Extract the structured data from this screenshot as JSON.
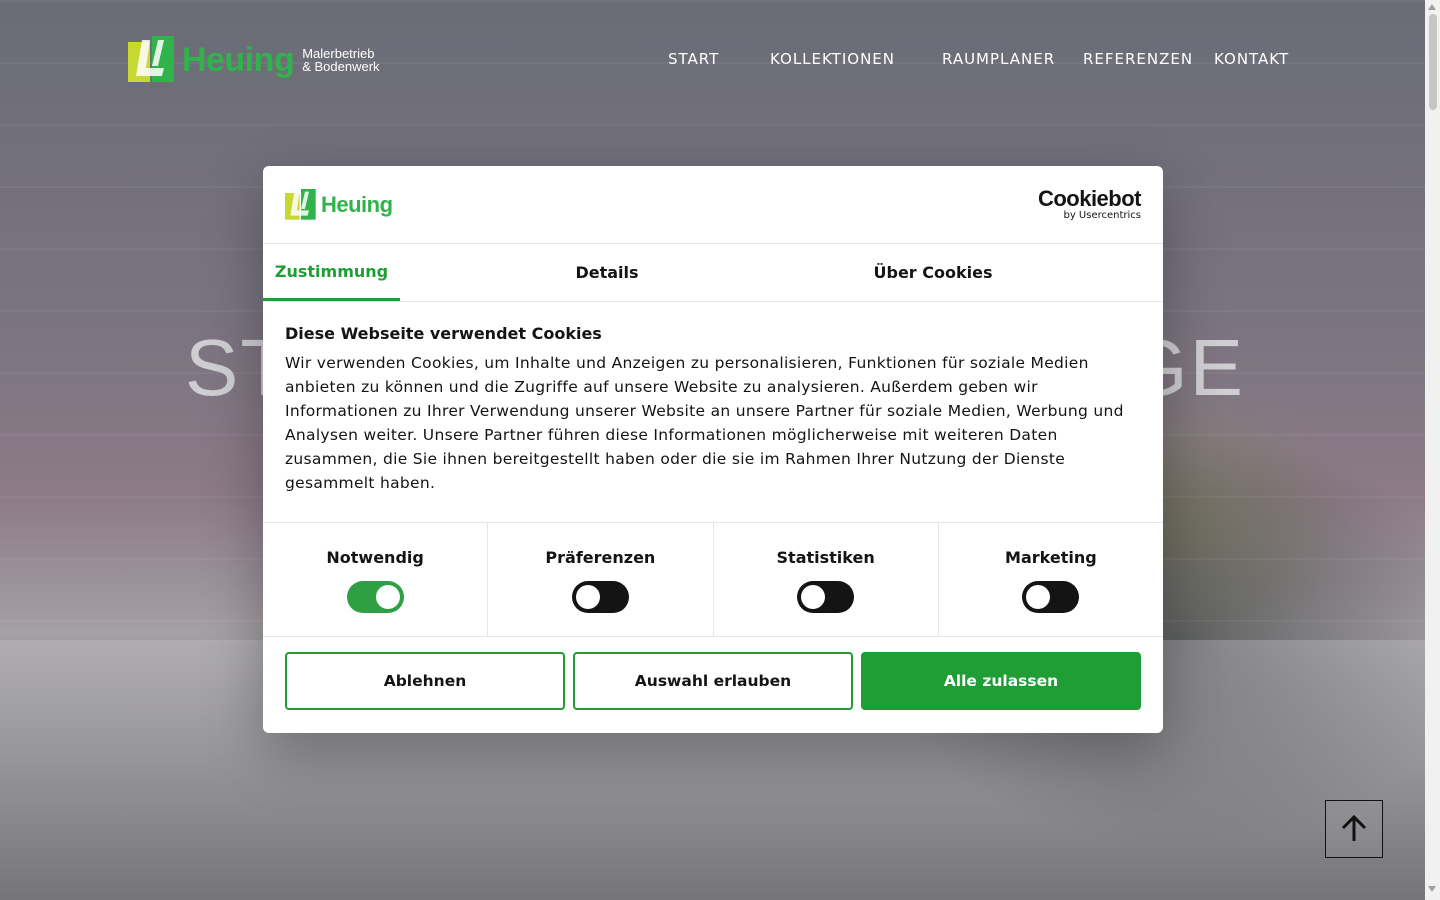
{
  "brand": {
    "name": "Heuing",
    "tagline_line1": "Malerbetrieb",
    "tagline_line2": "& Bodenwerk",
    "green": "#2fb34a",
    "lime": "#c8d832"
  },
  "nav": {
    "items": [
      {
        "label": "START"
      },
      {
        "label": "KOLLEKTIONEN"
      },
      {
        "label": "RAUMPLANER"
      },
      {
        "label": "REFERENZEN"
      },
      {
        "label": "KONTAKT"
      }
    ]
  },
  "hero": {
    "title_left": "ST",
    "title_right": "GE"
  },
  "cookie_dialog": {
    "logo_text": "Heuing",
    "provider": "Cookiebot",
    "provider_sub": "by Usercentrics",
    "tabs": [
      {
        "label": "Zustimmung",
        "active": true
      },
      {
        "label": "Details",
        "active": false
      },
      {
        "label": "Über Cookies",
        "active": false
      }
    ],
    "heading": "Diese Webseite verwendet Cookies",
    "body": "Wir verwenden Cookies, um Inhalte und Anzeigen zu personalisieren, Funktionen für soziale Medien anbieten zu können und die Zugriffe auf unsere Website zu analysieren. Außerdem geben wir Informationen zu Ihrer Verwendung unserer Website an unsere Partner für soziale Medien, Werbung und Analysen weiter. Unsere Partner führen diese Informationen möglicherweise mit weiteren Daten zusammen, die Sie ihnen bereitgestellt haben oder die sie im Rahmen Ihrer Nutzung der Dienste gesammelt haben.",
    "categories": [
      {
        "label": "Notwendig",
        "enabled": true
      },
      {
        "label": "Präferenzen",
        "enabled": false
      },
      {
        "label": "Statistiken",
        "enabled": false
      },
      {
        "label": "Marketing",
        "enabled": false
      }
    ],
    "buttons": {
      "decline": "Ablehnen",
      "allow_selection": "Auswahl erlauben",
      "allow_all": "Alle zulassen"
    },
    "accent": "#1f9e35"
  }
}
